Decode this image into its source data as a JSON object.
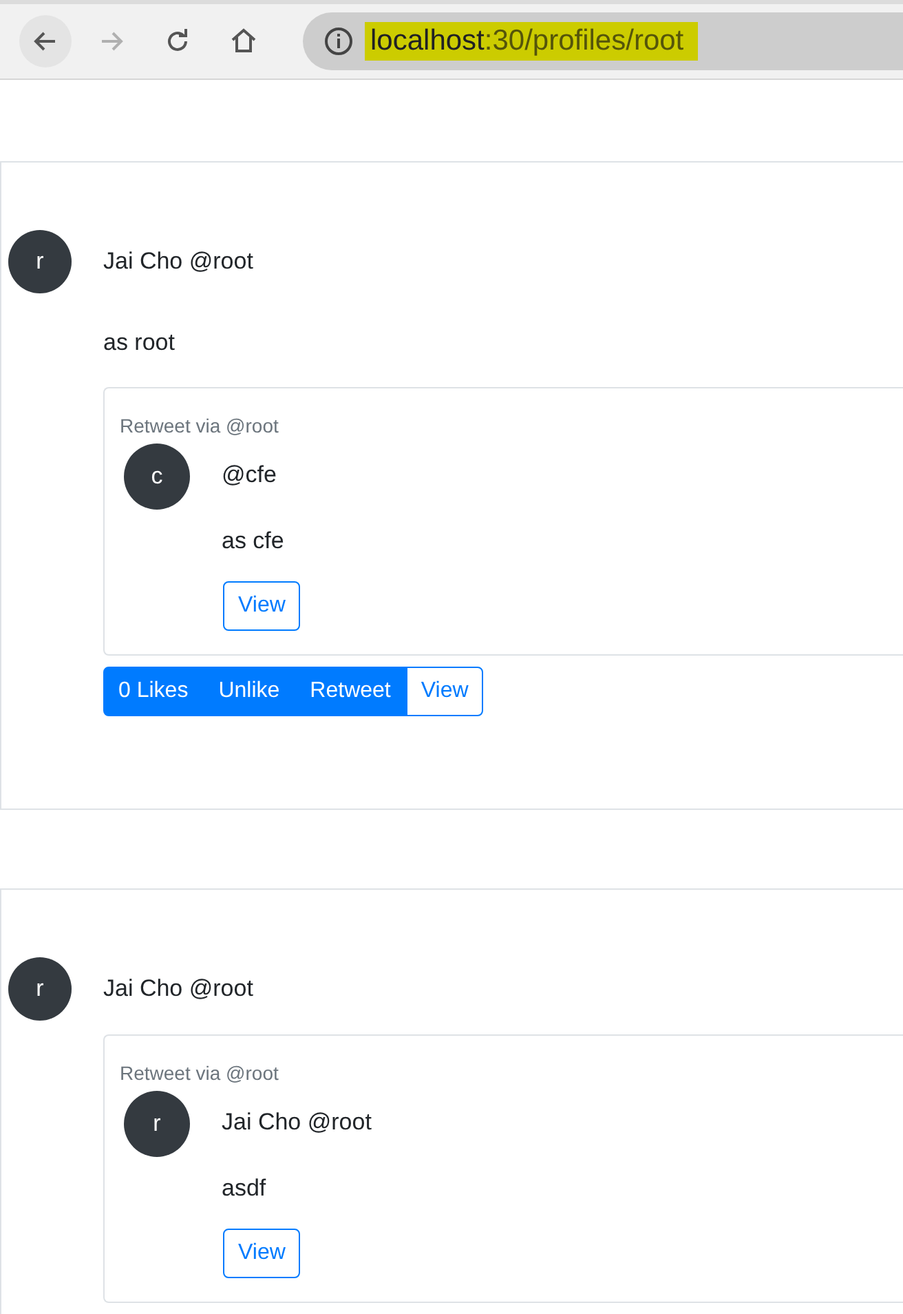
{
  "browser": {
    "url_host": "localhost",
    "url_path": ":30/profiles/root",
    "url_highlighted": true,
    "forward_disabled": true
  },
  "posts": [
    {
      "avatar_letter": "r",
      "author": "Jai Cho @root",
      "content": "as root",
      "retweet": {
        "label": "Retweet via @root",
        "avatar_letter": "c",
        "author": "@cfe",
        "content": "as cfe",
        "button": "View"
      },
      "actions": [
        {
          "label": "0 Likes",
          "kind": "primary"
        },
        {
          "label": "Unlike",
          "kind": "primary"
        },
        {
          "label": "Retweet",
          "kind": "primary"
        },
        {
          "label": "View",
          "kind": "outline"
        }
      ]
    },
    {
      "avatar_letter": "r",
      "author": "Jai Cho @root",
      "retweet": {
        "label": "Retweet via @root",
        "avatar_letter": "r",
        "author": "Jai Cho @root",
        "content": "asdf",
        "button": "View"
      }
    }
  ]
}
